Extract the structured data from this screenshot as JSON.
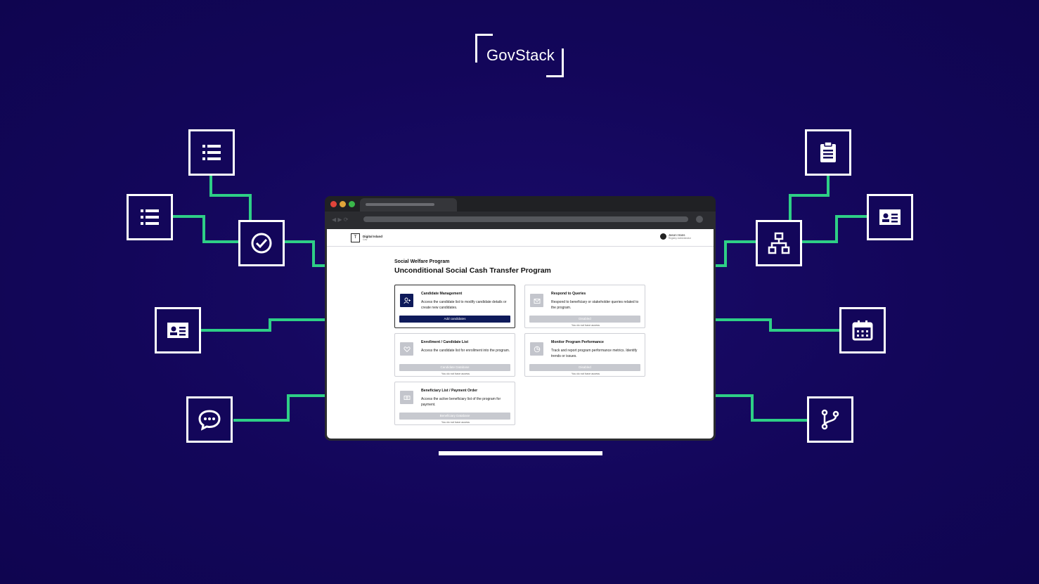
{
  "logo": {
    "text": "GovStack"
  },
  "browser": {
    "traffic_colors": [
      "#e0443a",
      "#e0a53a",
      "#3ab84a"
    ]
  },
  "app": {
    "brand_name": "Digital Island",
    "brand_sub": "Gov",
    "user_name": "Jason Hans",
    "user_role": "Registry Administrator",
    "program_category": "Social Welfare Program",
    "program_title": "Unconditional Social Cash Transfer Program",
    "cards": [
      {
        "title": "Candidate Management",
        "desc": "Access the candidate list to modify candidate details or create new candidates.",
        "button": "Add candidates",
        "note": ""
      },
      {
        "title": "Respond to Queries",
        "desc": "Respond to beneficiary or stakeholder queries related to the program.",
        "button": "Disabled",
        "note": "You do not have access"
      },
      {
        "title": "Enrollment / Candidate List",
        "desc": "Access the candidate list for enrollment into the program.",
        "button": "Candidate Database",
        "note": "You do not have access"
      },
      {
        "title": "Monitor Program Performance",
        "desc": "Track and report program performance metrics. Identify trends or issues.",
        "button": "Disabled",
        "note": "You do not have access"
      },
      {
        "title": "Beneficiary List / Payment Order",
        "desc": "Access the active beneficiary list of the program for payment.",
        "button": "Beneficiary Database",
        "note": "You do not have access"
      }
    ]
  },
  "colors": {
    "background": "#13065a",
    "connector": "#2ecf86",
    "accent_button": "#0e1a5a"
  },
  "side_icons": [
    "list-icon",
    "list-icon",
    "check-circle-icon",
    "id-card-icon",
    "chat-icon",
    "clipboard-icon",
    "id-card-icon",
    "network-icon",
    "calendar-icon",
    "branch-icon"
  ]
}
